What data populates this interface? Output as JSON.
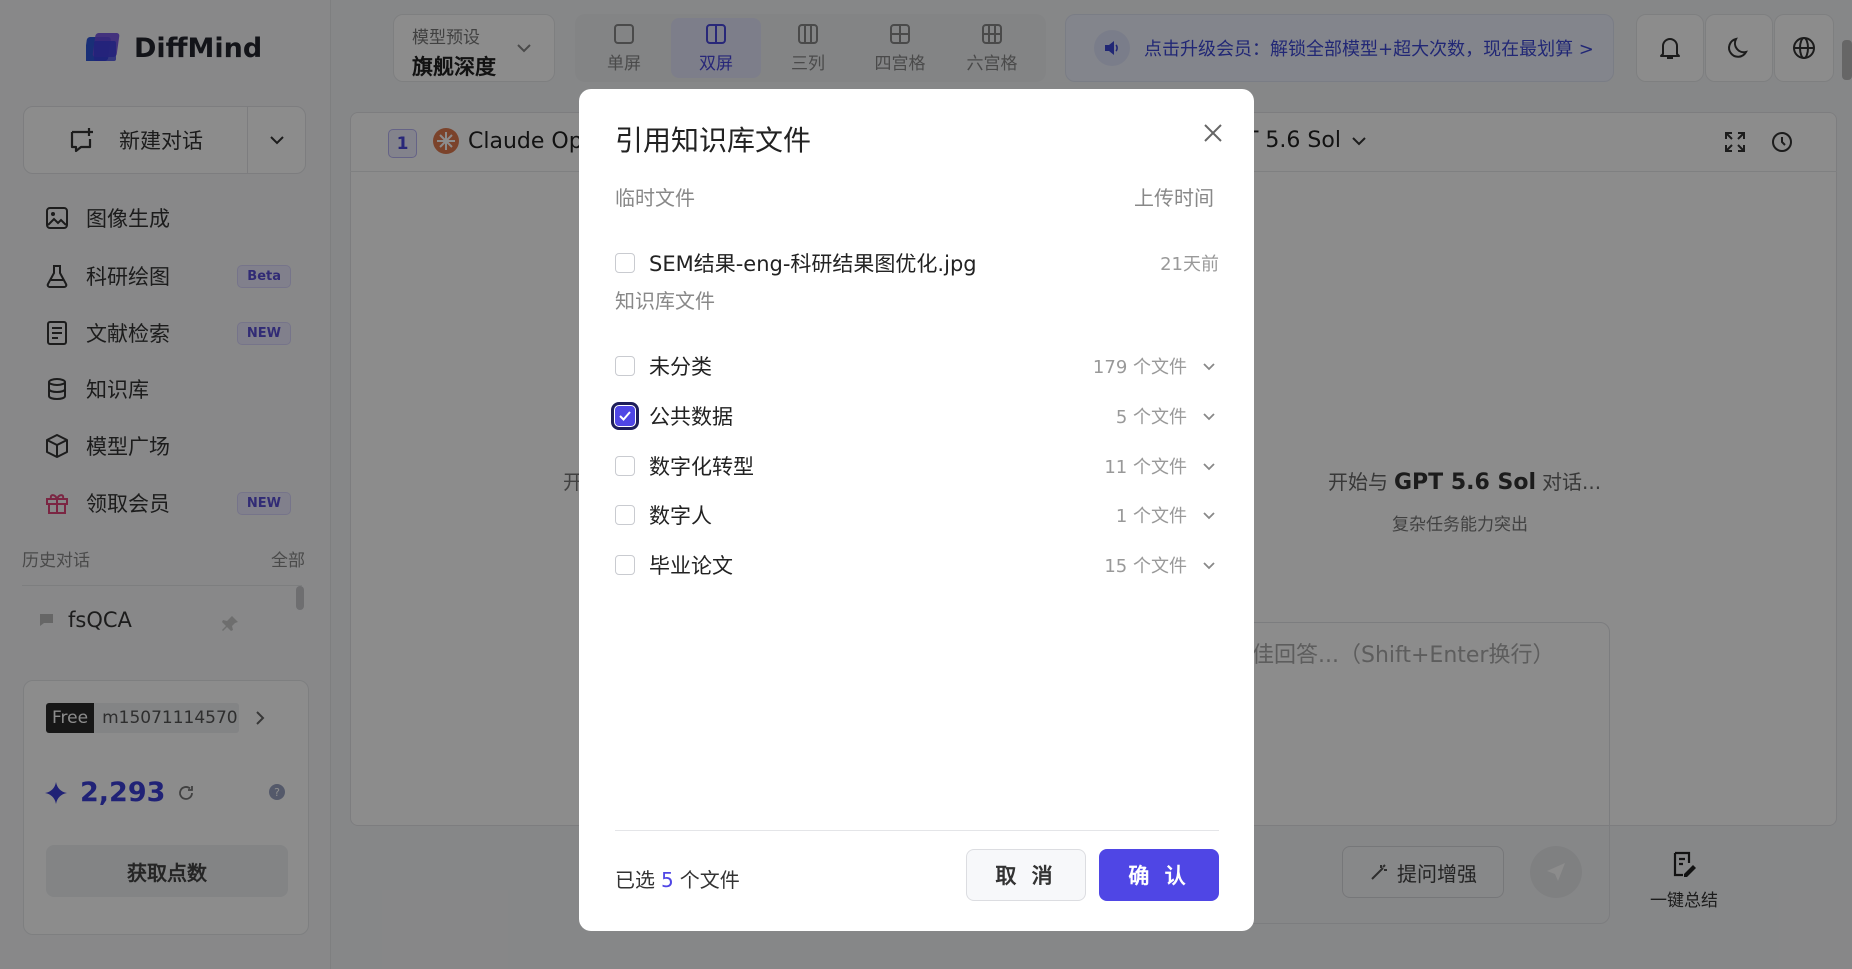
{
  "app": {
    "name": "DiffMind"
  },
  "sidebar": {
    "new_chat": "新建对话",
    "items": [
      {
        "label": "图像生成",
        "icon": "image-icon",
        "badge": ""
      },
      {
        "label": "科研绘图",
        "icon": "flask-icon",
        "badge": "Beta"
      },
      {
        "label": "文献检索",
        "icon": "document-icon",
        "badge": "NEW"
      },
      {
        "label": "知识库",
        "icon": "database-icon",
        "badge": ""
      },
      {
        "label": "模型广场",
        "icon": "cube-icon",
        "badge": ""
      },
      {
        "label": "领取会员",
        "icon": "gift-icon",
        "badge": "NEW"
      }
    ],
    "history_label": "历史对话",
    "history_all": "全部",
    "history_items": [
      {
        "label": "fsQCA"
      }
    ],
    "account": {
      "plan": "Free",
      "user": "m15071114570...",
      "points": "2,293",
      "get_points": "获取点数"
    }
  },
  "topbar": {
    "preset_label": "模型预设",
    "preset_value": "旗舰深度",
    "layouts": [
      {
        "label": "单屏",
        "active": false
      },
      {
        "label": "双屏",
        "active": true
      },
      {
        "label": "三列",
        "active": false
      },
      {
        "label": "四宫格",
        "active": false
      },
      {
        "label": "六宫格",
        "active": false
      }
    ],
    "upgrade_text": "点击升级会员：解锁全部模型+超大次数，现在最划算 >"
  },
  "content": {
    "panel_index": "1",
    "model_left": "Claude Opu",
    "model_right": "T 5.6 Sol",
    "left_start": "开",
    "right_start_prefix": "开始与",
    "right_model": "GPT 5.6 Sol",
    "right_start_suffix": "对话...",
    "right_sub": "复杂任务能力突出",
    "input_placeholder": "佳回答...（Shift+Enter换行）",
    "enhance_label": "提问增强",
    "summary_label": "一键总结"
  },
  "modal": {
    "title": "引用知识库文件",
    "temp_section": "临时文件",
    "upload_time_header": "上传时间",
    "temp_files": [
      {
        "name": "SEM结果-eng-科研结果图优化.jpg",
        "time": "21天前",
        "checked": false
      }
    ],
    "kb_section": "知识库文件",
    "kb_folders": [
      {
        "name": "未分类",
        "count": "179 个文件",
        "checked": false
      },
      {
        "name": "公共数据",
        "count": "5 个文件",
        "checked": true
      },
      {
        "name": "数字化转型",
        "count": "11 个文件",
        "checked": false
      },
      {
        "name": "数字人",
        "count": "1 个文件",
        "checked": false
      },
      {
        "name": "毕业论文",
        "count": "15 个文件",
        "checked": false
      }
    ],
    "selected_prefix": "已选",
    "selected_count": "5",
    "selected_suffix": "个文件",
    "cancel": "取 消",
    "confirm": "确 认"
  },
  "colors": {
    "accent": "#4f46e5",
    "brand_blue": "#3b3fd8",
    "badge_purple": "#5a4fd6",
    "gift_red": "#e0457b"
  }
}
